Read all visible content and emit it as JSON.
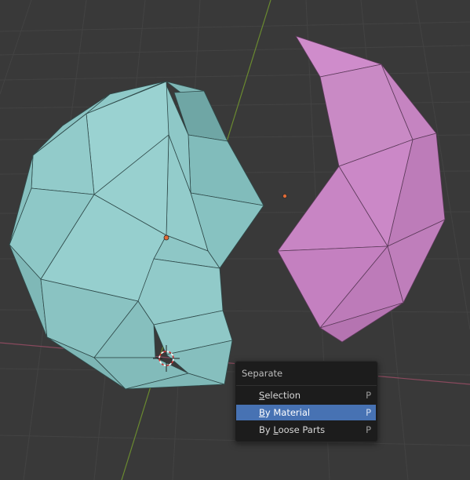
{
  "viewport": {
    "background": "#393939",
    "grid_color": "#404040",
    "x_axis_color": "#8a4a5e",
    "y_axis_color": "#6a8a30",
    "mesh_left_color": "#8cc7c6",
    "mesh_right_color": "#c77fbf"
  },
  "menu": {
    "title": "Separate",
    "items": [
      {
        "pre": "",
        "ul": "S",
        "post": "election",
        "shortcut": "P",
        "active": false
      },
      {
        "pre": "",
        "ul": "B",
        "post": "y Material",
        "shortcut": "P",
        "active": true
      },
      {
        "pre": "By ",
        "ul": "L",
        "post": "oose Parts",
        "shortcut": "P",
        "active": false
      }
    ]
  }
}
